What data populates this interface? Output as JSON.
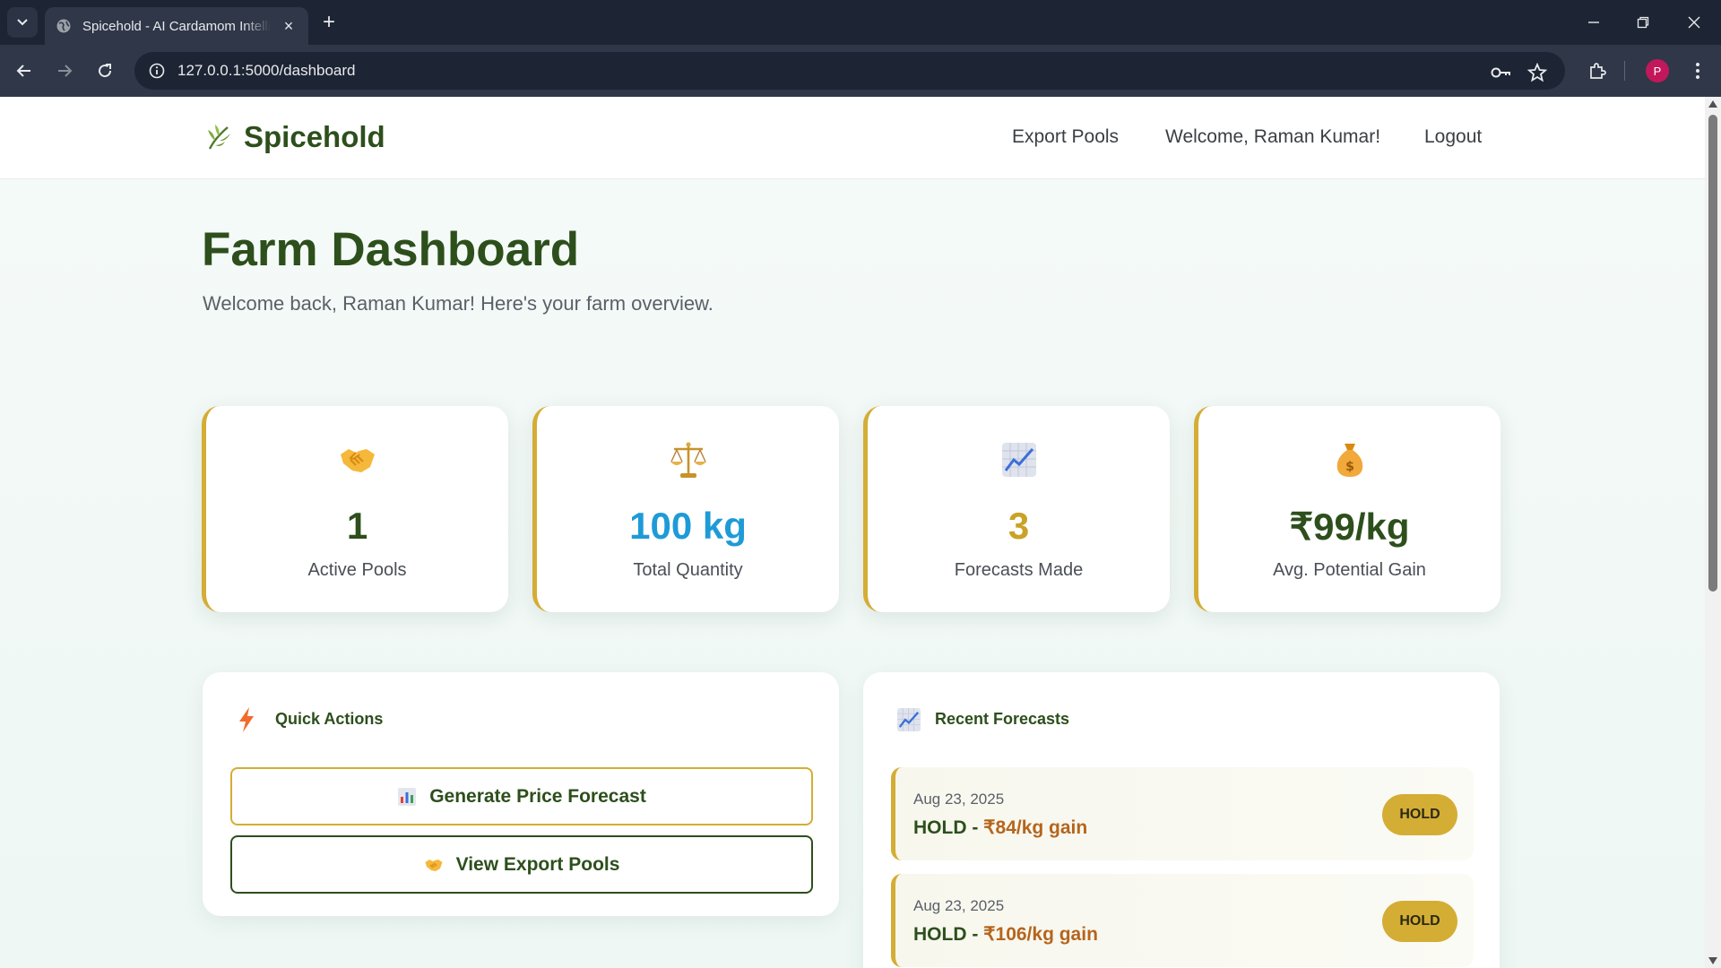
{
  "browser": {
    "tab_title": "Spicehold - AI Cardamom Intelligence",
    "tab_close": "×",
    "new_tab": "+",
    "url": "127.0.0.1:5000/dashboard",
    "profile_initial": "P"
  },
  "header": {
    "brand": "Spicehold",
    "nav": {
      "export_pools": "Export Pools",
      "welcome": "Welcome, Raman Kumar!",
      "logout": "Logout"
    }
  },
  "main": {
    "title": "Farm Dashboard",
    "subtitle": "Welcome back, Raman Kumar! Here's your farm overview."
  },
  "stats": [
    {
      "icon": "handshake-icon",
      "value": "1",
      "label": "Active Pools",
      "color": "#2d4f1c"
    },
    {
      "icon": "balance-scale-icon",
      "value": "100 kg",
      "label": "Total Quantity",
      "color": "#1e9bd7"
    },
    {
      "icon": "chart-increasing-icon",
      "value": "3",
      "label": "Forecasts Made",
      "color": "#c9a227"
    },
    {
      "icon": "money-bag-icon",
      "value": "₹99/kg",
      "label": "Avg. Potential Gain",
      "color": "#2d4f1c"
    }
  ],
  "quick_actions": {
    "title": "Quick Actions",
    "buttons": [
      {
        "icon": "bar-chart-icon",
        "label": "Generate Price Forecast",
        "border_color": "#d4ad35"
      },
      {
        "icon": "handshake-icon",
        "label": "View Export Pools",
        "border_color": "#2d4f1c"
      }
    ]
  },
  "recent_forecasts": {
    "title": "Recent Forecasts",
    "items": [
      {
        "date": "Aug 23, 2025",
        "action": "HOLD - ",
        "gain": "₹84/kg gain",
        "badge": "HOLD"
      },
      {
        "date": "Aug 23, 2025",
        "action": "HOLD - ",
        "gain": "₹106/kg gain",
        "badge": "HOLD"
      }
    ]
  },
  "colors": {
    "brand_green": "#2d4f1c",
    "accent_gold": "#d4ad35",
    "gain_orange": "#b5651d"
  }
}
